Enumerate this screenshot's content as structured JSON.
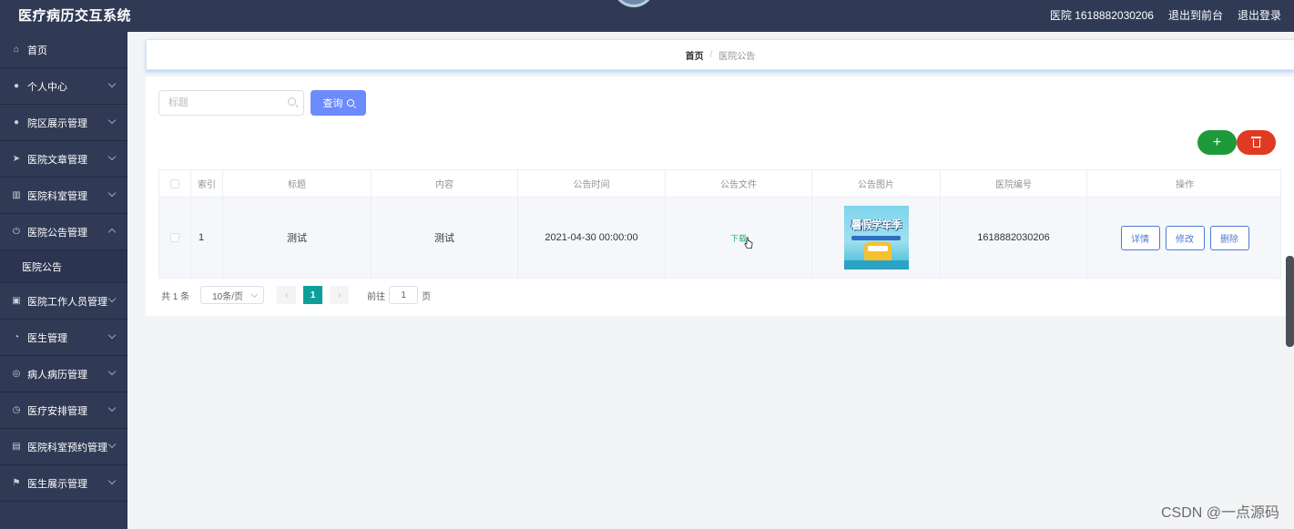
{
  "header": {
    "app_title": "医疗病历交互系统",
    "user_label": "医院 1618882030206",
    "back_to_front": "退出到前台",
    "logout": "退出登录"
  },
  "sidebar": {
    "items": [
      {
        "label": "首页",
        "icon": "home-icon"
      },
      {
        "label": "个人中心",
        "icon": "user-icon"
      },
      {
        "label": "院区展示管理",
        "icon": "user-icon"
      },
      {
        "label": "医院文章管理",
        "icon": "send-icon"
      },
      {
        "label": "医院科室管理",
        "icon": "columns-icon"
      },
      {
        "label": "医院公告管理",
        "icon": "power-icon",
        "sub": "医院公告"
      },
      {
        "label": "医院工作人员管理",
        "icon": "briefcase-icon"
      },
      {
        "label": "医生管理",
        "icon": "gauge-icon"
      },
      {
        "label": "病人病历管理",
        "icon": "lifebuoy-icon"
      },
      {
        "label": "医疗安排管理",
        "icon": "clock-icon"
      },
      {
        "label": "医院科室预约管理",
        "icon": "clipboard-icon"
      },
      {
        "label": "医生展示管理",
        "icon": "flag-icon"
      }
    ]
  },
  "breadcrumb": {
    "home": "首页",
    "separator": "/",
    "current": "医院公告"
  },
  "search": {
    "placeholder": "标题",
    "query_label": "查询"
  },
  "toolbar": {
    "add_label": "+",
    "colors": {
      "add": "#1f9a3a",
      "delete": "#e13a22",
      "query": "#6c8bfc",
      "active_page": "#0e9f9a"
    }
  },
  "table": {
    "headers": [
      "索引",
      "标题",
      "内容",
      "公告时间",
      "公告文件",
      "公告图片",
      "医院编号",
      "操作"
    ],
    "rows": [
      {
        "index": "1",
        "title": "测试",
        "content": "测试",
        "time": "2021-04-30 00:00:00",
        "file": "下载",
        "image_text": "暑假学车季",
        "code": "1618882030206",
        "ops": [
          "详情",
          "修改",
          "删除"
        ]
      }
    ]
  },
  "pagination": {
    "total": "共 1 条",
    "page_size": "10条/页",
    "prev": "‹",
    "current": "1",
    "next": "›",
    "goto": "前往",
    "goto_value": "1",
    "page_unit": "页"
  },
  "watermark": "CSDN @一点源码"
}
